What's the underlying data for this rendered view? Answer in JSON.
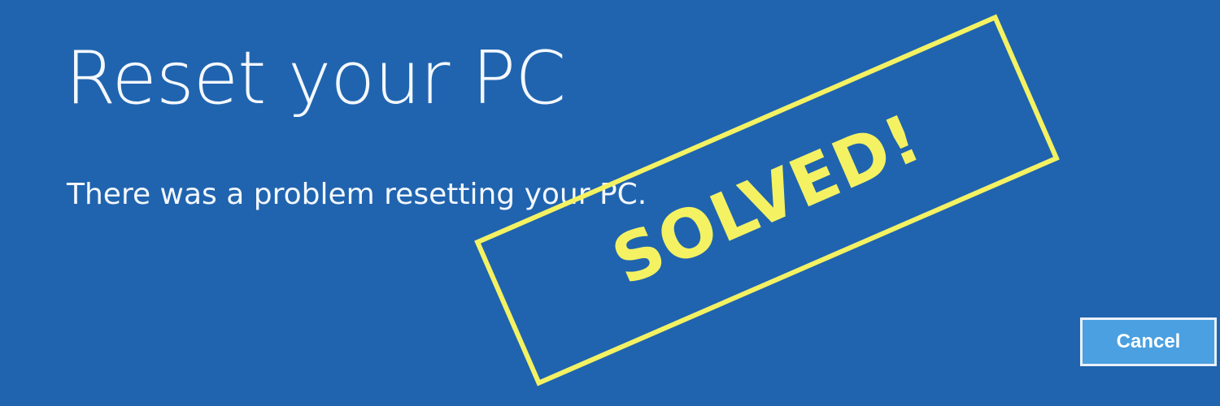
{
  "dialog": {
    "title": "Reset your PC",
    "message": "There was a problem resetting your PC.",
    "cancel_label": "Cancel"
  },
  "overlay": {
    "stamp_text": "SOLVED!",
    "stamp_color": "#f4f262"
  },
  "colors": {
    "background": "#2064af",
    "text": "#f4f8fd",
    "button_fill": "#4aa0e0",
    "button_border": "#e9f0f9"
  }
}
